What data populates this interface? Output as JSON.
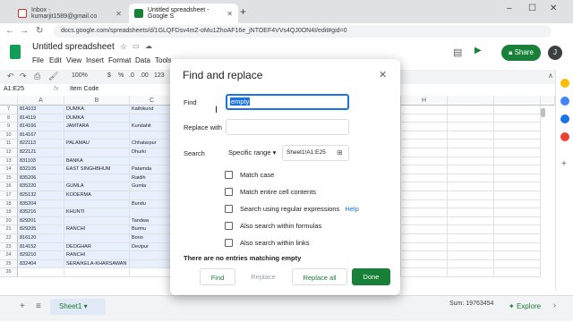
{
  "browser": {
    "tabs": [
      {
        "label": "Inbox - kumarjit1589@gmail.co",
        "active": false
      },
      {
        "label": "Untitled spreadsheet - Google S",
        "active": true
      }
    ],
    "url": "docs.google.com/spreadsheets/d/1GLQFDsv4mZ-oMu1ZhoAF16e_jNTOEF4VVs4QJ0ON4I/edit#gid=0"
  },
  "sheets": {
    "title": "Untitled spreadsheet",
    "menu": [
      "File",
      "Edit",
      "View",
      "Insert",
      "Format",
      "Data",
      "Tools"
    ],
    "share_label": "Share",
    "avatar_letter": "J",
    "zoom": "100%",
    "font_size_menu": "123",
    "name_box": "A1:E25",
    "formula_value": "Item Code"
  },
  "grid": {
    "columns": [
      "A",
      "B",
      "C",
      "",
      "",
      "",
      "",
      "",
      "H",
      "",
      "",
      "",
      "",
      "",
      ""
    ],
    "rows": [
      {
        "num": "7",
        "a": "814103",
        "b": "DUMKA",
        "c": "Kathikund"
      },
      {
        "num": "8",
        "a": "814119",
        "b": "DUMKA",
        "c": ""
      },
      {
        "num": "9",
        "a": "814166",
        "b": "JAMTARA",
        "c": "Kundahit"
      },
      {
        "num": "10",
        "a": "814167",
        "b": "",
        "c": ""
      },
      {
        "num": "11",
        "a": "822113",
        "b": "PALAMAU",
        "c": "Chhatarpur"
      },
      {
        "num": "12",
        "a": "822121",
        "b": "",
        "c": "Dhurki"
      },
      {
        "num": "13",
        "a": "831103",
        "b": "BANKA",
        "c": ""
      },
      {
        "num": "14",
        "a": "832105",
        "b": "EAST SINGHBHUM",
        "c": "Patamda"
      },
      {
        "num": "15",
        "a": "835206",
        "b": "",
        "c": "Raidih"
      },
      {
        "num": "16",
        "a": "835220",
        "b": "GUMLA",
        "c": "Gumla"
      },
      {
        "num": "17",
        "a": "825132",
        "b": "KODERMA",
        "c": ""
      },
      {
        "num": "18",
        "a": "835204",
        "b": "",
        "c": "Bundu"
      },
      {
        "num": "19",
        "a": "835216",
        "b": "KHUNTI",
        "c": ""
      },
      {
        "num": "20",
        "a": "829201",
        "b": "",
        "c": "Tandwa"
      },
      {
        "num": "21",
        "a": "829205",
        "b": "RANCHI",
        "c": "Burmu"
      },
      {
        "num": "22",
        "a": "816120",
        "b": "",
        "c": "Borio"
      },
      {
        "num": "23",
        "a": "814152",
        "b": "DEOGHAR",
        "c": "Devipur"
      },
      {
        "num": "24",
        "a": "829210",
        "b": "RANCHI",
        "c": ""
      },
      {
        "num": "25",
        "a": "832404",
        "b": "SERAIKELA-KHARSAWAN",
        "c": ""
      },
      {
        "num": "26",
        "a": "",
        "b": "",
        "c": ""
      }
    ]
  },
  "bottom": {
    "sheet_tab": "Sheet1",
    "sum": "Sum: 19763454",
    "explore": "Explore"
  },
  "dialog": {
    "title": "Find and replace",
    "find_label": "Find",
    "find_value": "empty",
    "replace_label": "Replace with",
    "search_label": "Search",
    "search_scope": "Specific range",
    "range": "Sheet1!A1:E25",
    "options": [
      "Match case",
      "Match entire cell contents",
      "Search using regular expressions",
      "Also search within formulas",
      "Also search within links"
    ],
    "help_label": "Help",
    "status": "There are no entries matching empty",
    "buttons": {
      "find": "Find",
      "replace": "Replace",
      "replace_all": "Replace all",
      "done": "Done"
    }
  },
  "colors": {
    "accent": "#188038",
    "focus": "#1a73e8",
    "selection": "#e8f0fe"
  }
}
